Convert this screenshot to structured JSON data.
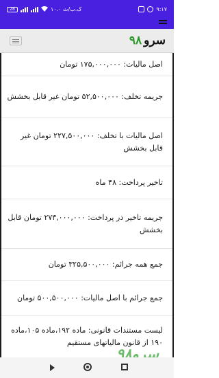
{
  "status_bar": {
    "time": "۹:۱۷",
    "data_speed": "۱۰.۰ ک.ب/ث",
    "battery": "28"
  },
  "header": {
    "logo_word": "سرو",
    "logo_number": "۹۸"
  },
  "items": [
    "اصل مالیات: ۱۷۵,۰۰۰,۰۰۰ تومان",
    "جریمه تخلف: ۵۲,۵۰۰,۰۰۰ تومان غیر قابل بخشش",
    "اصل مالیات با تخلف: ۲۲۷,۵۰۰,۰۰۰ تومان غیر قابل بخشش",
    "تاخیر پرداخت: ۴۸ ماه",
    "جریمه تاخیر در پرداخت: ۲۷۳,۰۰۰,۰۰۰ تومان قابل بخشش",
    "جمع همه جرائم: ۳۲۵,۵۰۰,۰۰۰ تومان",
    "جمع جرائم با اصل مالیات: ۵۰۰,۵۰۰,۰۰۰ تومان",
    "لیست مستندات قانونی: ماده ۱۹۲،ماده ۱۰۵،ماده ۱۹۰ از قانون مالیاتهای مستقیم"
  ],
  "watermark": "سرو۹۸",
  "colors": {
    "status_bar": "#4a20e0",
    "logo_accent": "#2a9a2a"
  }
}
